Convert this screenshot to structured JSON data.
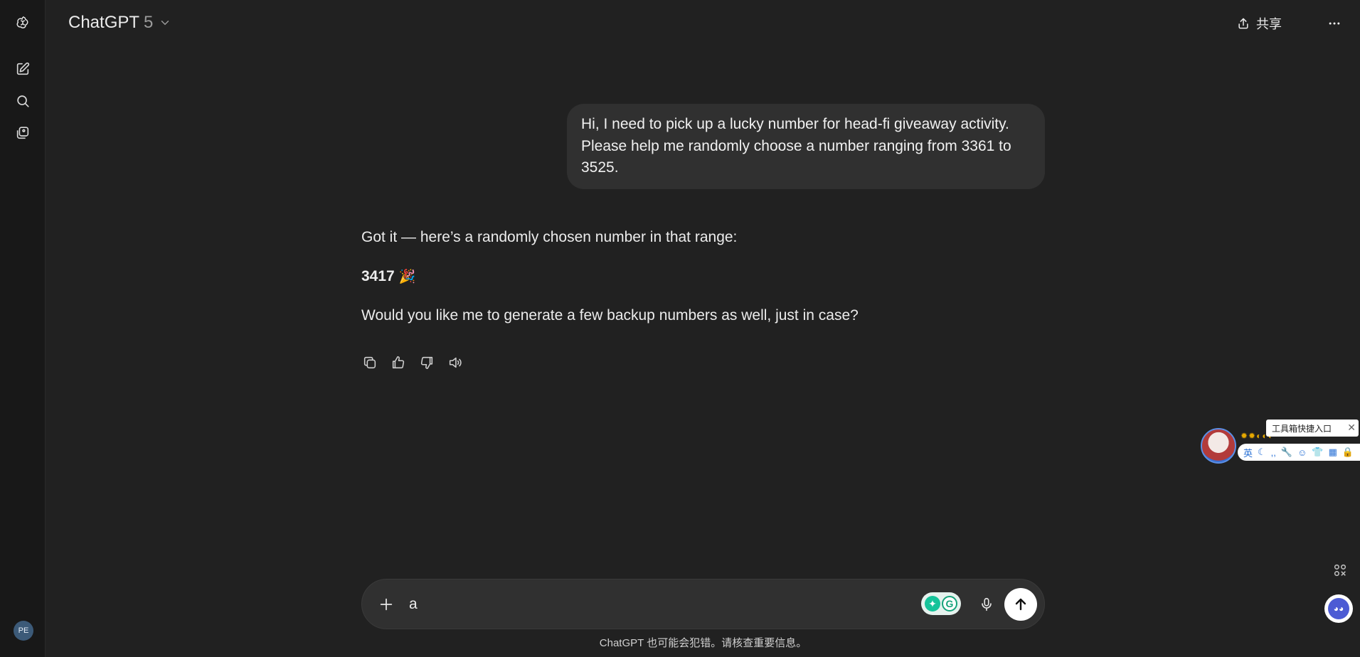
{
  "header": {
    "model_name": "ChatGPT",
    "model_version": "5",
    "share_label": "共享"
  },
  "sidebar": {
    "avatar_initials": "PE"
  },
  "conversation": {
    "user_message": "Hi, I need to pick up a lucky number for head-fi giveaway activity. Please help me randomly choose a number ranging from 3361 to 3525.",
    "assistant_intro": "Got it — here’s a randomly chosen number in that range:",
    "assistant_number": "3417",
    "assistant_emoji": "🎉",
    "assistant_followup": "Would you like me to generate a few backup numbers as well, just in case?"
  },
  "composer": {
    "input_value": "a",
    "disclaimer": "ChatGPT 也可能会犯错。请核查重要信息。"
  },
  "tool_widget": {
    "tooltip": "工具箱快捷入口",
    "close_glyph": "✕",
    "lang_label": "英",
    "badges": "✹✹◐◐◐"
  },
  "colors": {
    "background": "#212121",
    "rail": "#181818",
    "bubble": "#303030",
    "text": "#ececec"
  }
}
